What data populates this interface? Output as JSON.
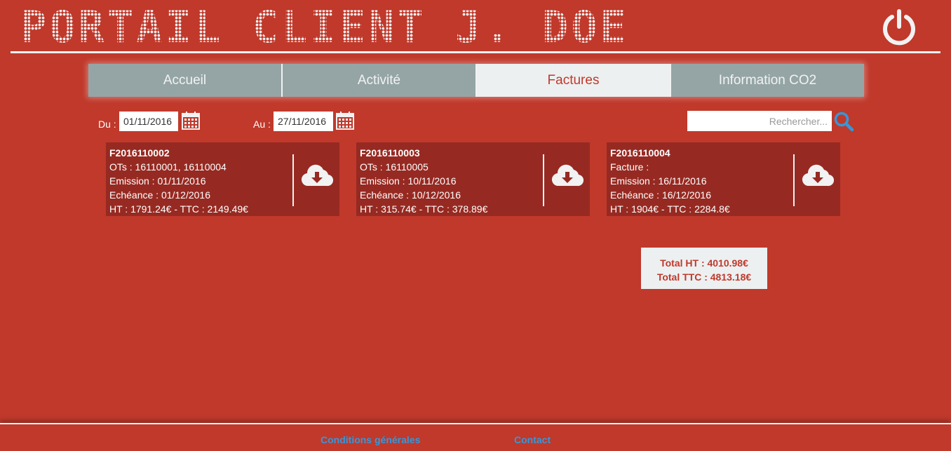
{
  "header": {
    "title": "Portail Client J. Doe",
    "power_icon": "power-icon"
  },
  "tabs": [
    {
      "label": "Accueil",
      "active": false
    },
    {
      "label": "Activité",
      "active": false
    },
    {
      "label": "Factures",
      "active": true
    },
    {
      "label": "Information CO2",
      "active": false
    }
  ],
  "filters": {
    "from_label": "Du :",
    "from_value": "01/11/2016",
    "to_label": "Au :",
    "to_value": "27/11/2016",
    "search_placeholder": "Rechercher..."
  },
  "invoices": [
    {
      "id": "F2016110002",
      "ots": "OTs : 16110001, 16110004",
      "emission": "Emission : 01/11/2016",
      "echeance": "Echéance : 01/12/2016",
      "amounts": "HT : 1791.24€ - TTC : 2149.49€"
    },
    {
      "id": "F2016110003",
      "ots": "OTs : 16110005",
      "emission": "Emission : 10/11/2016",
      "echeance": "Echéance : 10/12/2016",
      "amounts": "HT : 315.74€ - TTC : 378.89€"
    },
    {
      "id": "F2016110004",
      "ots": "Facture :",
      "emission": "Emission : 16/11/2016",
      "echeance": "Echéance : 16/12/2016",
      "amounts": "HT : 1904€ - TTC : 2284.8€"
    }
  ],
  "totals": {
    "ht": "Total HT : 4010.98€",
    "ttc": "Total TTC : 4813.18€"
  },
  "footer": {
    "conditions": "Conditions générales",
    "contact": "Contact"
  },
  "colors": {
    "background": "#c0392b",
    "card": "#962a22",
    "tab": "#95a5a6",
    "tab_active": "#ecf0f1",
    "link": "#3498db"
  }
}
